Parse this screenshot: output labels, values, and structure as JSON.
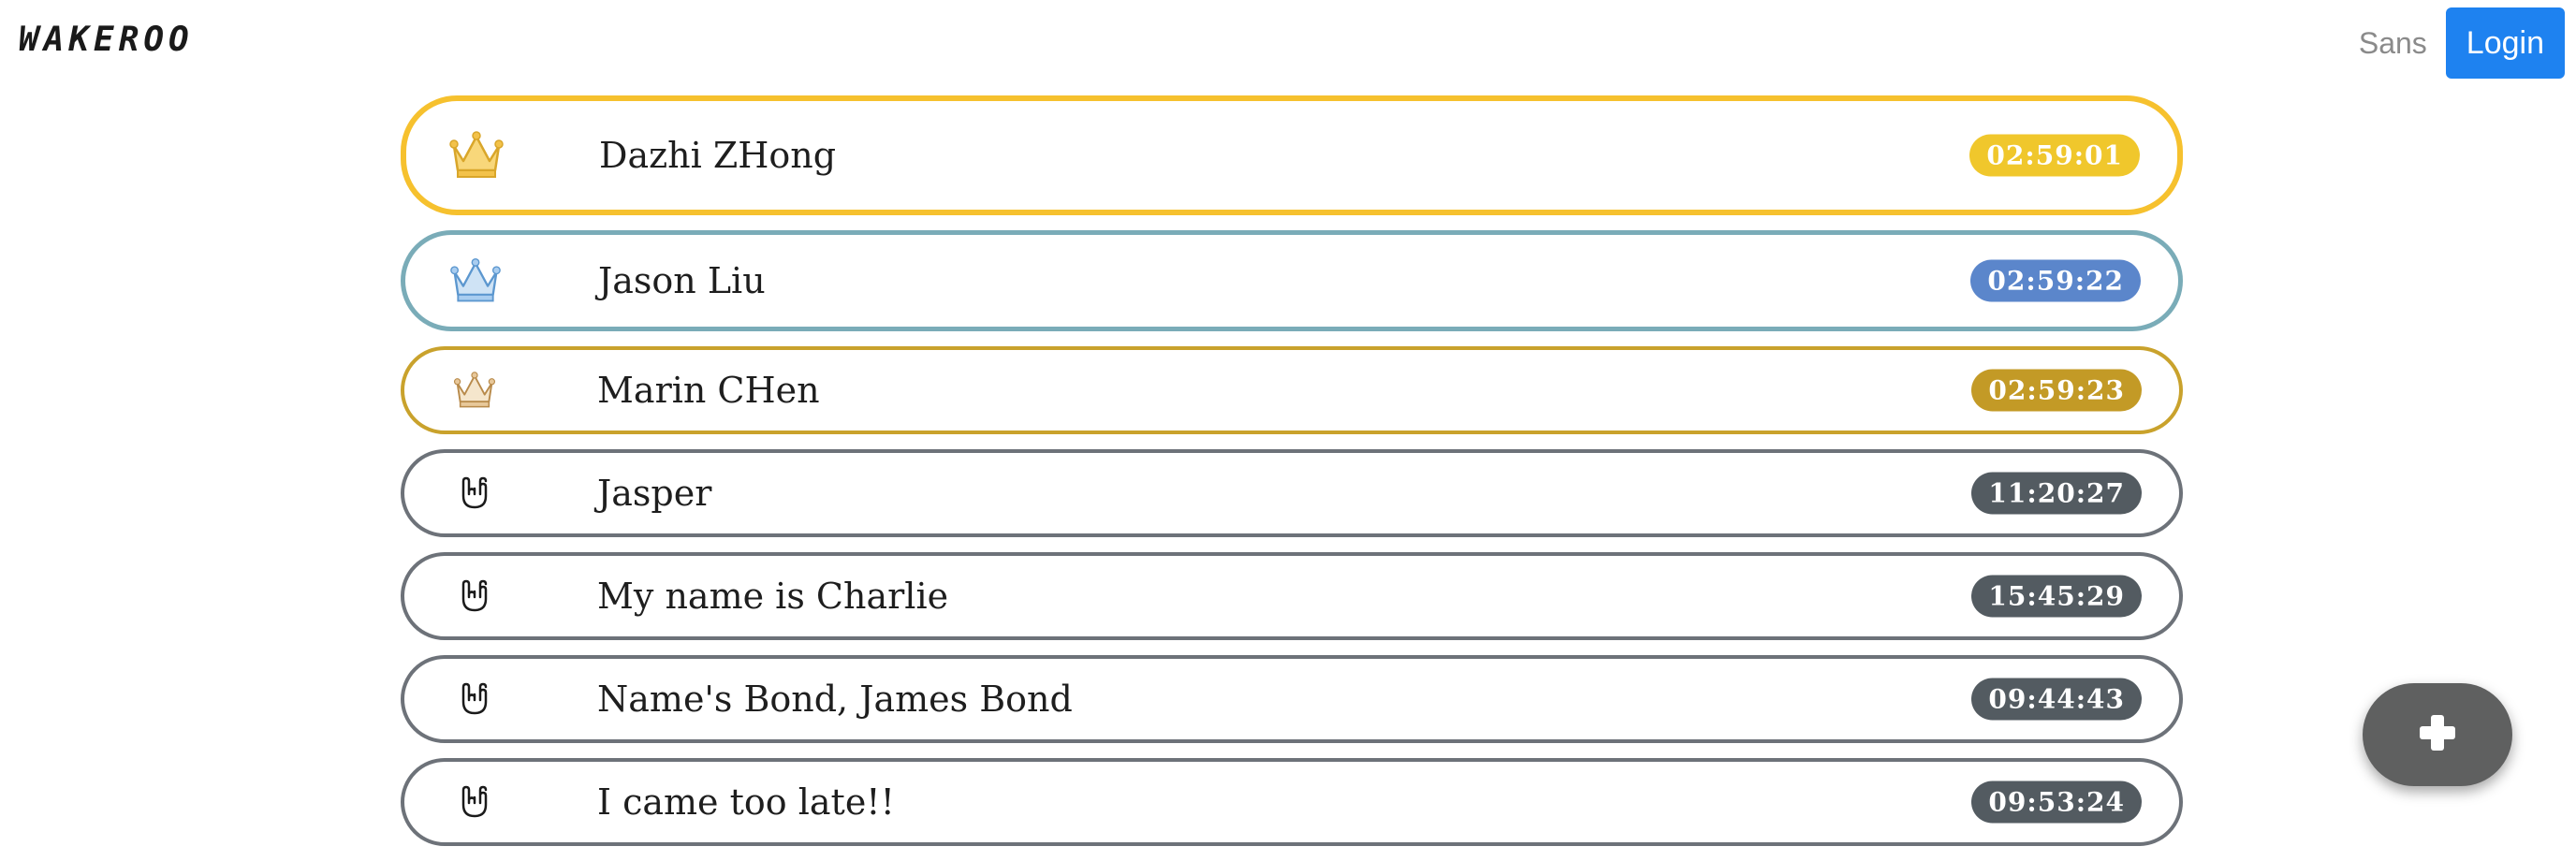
{
  "navbar": {
    "brand": "WAKEROO",
    "font_toggle": "Sans",
    "login_label": "Login"
  },
  "entries": [
    {
      "name": "Dazhi ZHong",
      "time": "02:59:01",
      "icon": "gold-crown-icon",
      "border_color": "#f6c12e",
      "badge_color": "#f0c72c"
    },
    {
      "name": "Jason Liu",
      "time": "02:59:22",
      "icon": "silver-crown-icon",
      "border_color": "#7aacb8",
      "badge_color": "#5b86cb"
    },
    {
      "name": "Marin CHen",
      "time": "02:59:23",
      "icon": "bronze-crown-icon",
      "border_color": "#c9a22c",
      "badge_color": "#c39a26"
    },
    {
      "name": "Jasper",
      "time": "11:20:27",
      "icon": "rock-hand-icon",
      "border_color": "#6d7279",
      "badge_color": "#535b61"
    },
    {
      "name": "My name is Charlie",
      "time": "15:45:29",
      "icon": "rock-hand-icon",
      "border_color": "#6d7279",
      "badge_color": "#535b61"
    },
    {
      "name": "Name's Bond, James Bond",
      "time": "09:44:43",
      "icon": "rock-hand-icon",
      "border_color": "#6d7279",
      "badge_color": "#535b61"
    },
    {
      "name": "I came too late!!",
      "time": "09:53:24",
      "icon": "rock-hand-icon",
      "border_color": "#6d7279",
      "badge_color": "#535b61"
    }
  ],
  "fab": {
    "icon": "plus-icon"
  }
}
